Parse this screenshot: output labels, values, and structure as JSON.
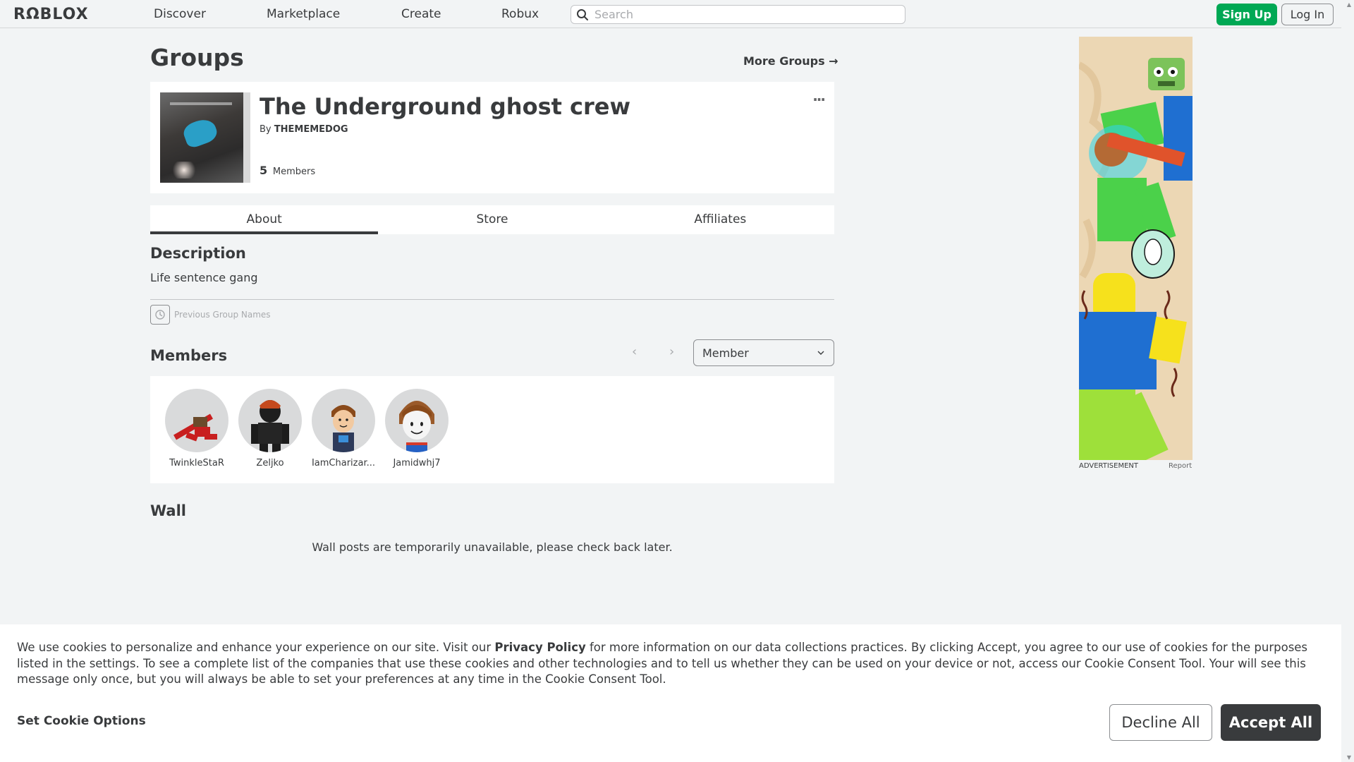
{
  "header": {
    "logo": "RΩBLOX",
    "nav": [
      "Discover",
      "Marketplace",
      "Create",
      "Robux"
    ],
    "search_placeholder": "Search",
    "signup_label": "Sign Up",
    "login_label": "Log In"
  },
  "page": {
    "title": "Groups",
    "more_groups": "More Groups →"
  },
  "group": {
    "name": "The Underground ghost crew",
    "by_label": "By",
    "owner": "THEMEMEDOG",
    "member_count": "5",
    "member_label": "Members",
    "more_icon": "..."
  },
  "tabs": [
    {
      "label": "About",
      "active": true
    },
    {
      "label": "Store",
      "active": false
    },
    {
      "label": "Affiliates",
      "active": false
    }
  ],
  "about": {
    "description_title": "Description",
    "description_text": "Life sentence gang",
    "previous_names_label": "Previous Group Names"
  },
  "members": {
    "title": "Members",
    "role_select": "Member",
    "list": [
      {
        "name": "TwinkleStaR"
      },
      {
        "name": "Zeljko"
      },
      {
        "name": "IamCharizar..."
      },
      {
        "name": "Jamidwhj7"
      }
    ]
  },
  "wall": {
    "title": "Wall",
    "message": "Wall posts are temporarily unavailable, please check back later."
  },
  "ad": {
    "label": "ADVERTISEMENT",
    "report": "Report"
  },
  "cookie": {
    "text_before": "We use cookies to personalize and enhance your experience on our site. Visit our ",
    "privacy_link": "Privacy Policy",
    "text_after": " for more information on our data collections practices. By clicking Accept, you agree to our use of cookies for the purposes listed in the settings. To see a complete list of the companies that use these cookies and other technologies and to tell us whether they can be used on your device or not, access our Cookie Consent Tool. Your will see this message only once, but you will always be able to set your preferences at any time in the Cookie Consent Tool.",
    "set_options": "Set Cookie Options",
    "decline": "Decline All",
    "accept": "Accept All"
  },
  "colors": {
    "accent_green": "#00a854",
    "text_dark": "#393b3d",
    "page_bg": "#f2f4f5"
  }
}
